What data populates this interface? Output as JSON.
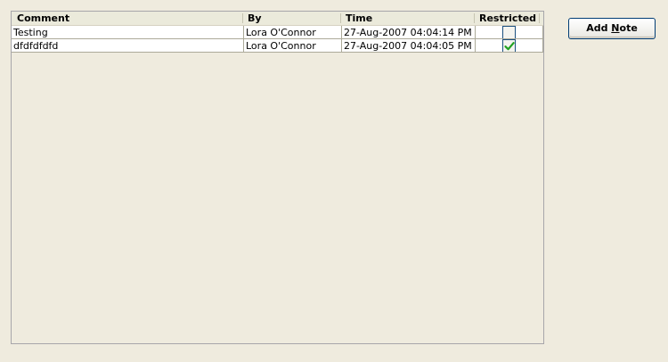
{
  "grid": {
    "columns": [
      {
        "key": "comment",
        "label": "Comment"
      },
      {
        "key": "by",
        "label": "By"
      },
      {
        "key": "time",
        "label": "Time"
      },
      {
        "key": "restricted",
        "label": "Restricted"
      }
    ],
    "rows": [
      {
        "comment": "Testing",
        "by": "Lora O'Connor",
        "time": "27-Aug-2007 04:04:14 PM",
        "restricted": false
      },
      {
        "comment": "dfdfdfdfd",
        "by": "Lora O'Connor",
        "time": "27-Aug-2007 04:04:05 PM",
        "restricted": true
      }
    ]
  },
  "add_note": {
    "label_before": "Add ",
    "label_mnemonic": "N",
    "label_after": "ote"
  },
  "colors": {
    "window_background": "#efebde",
    "check_mark": "#21a121"
  }
}
